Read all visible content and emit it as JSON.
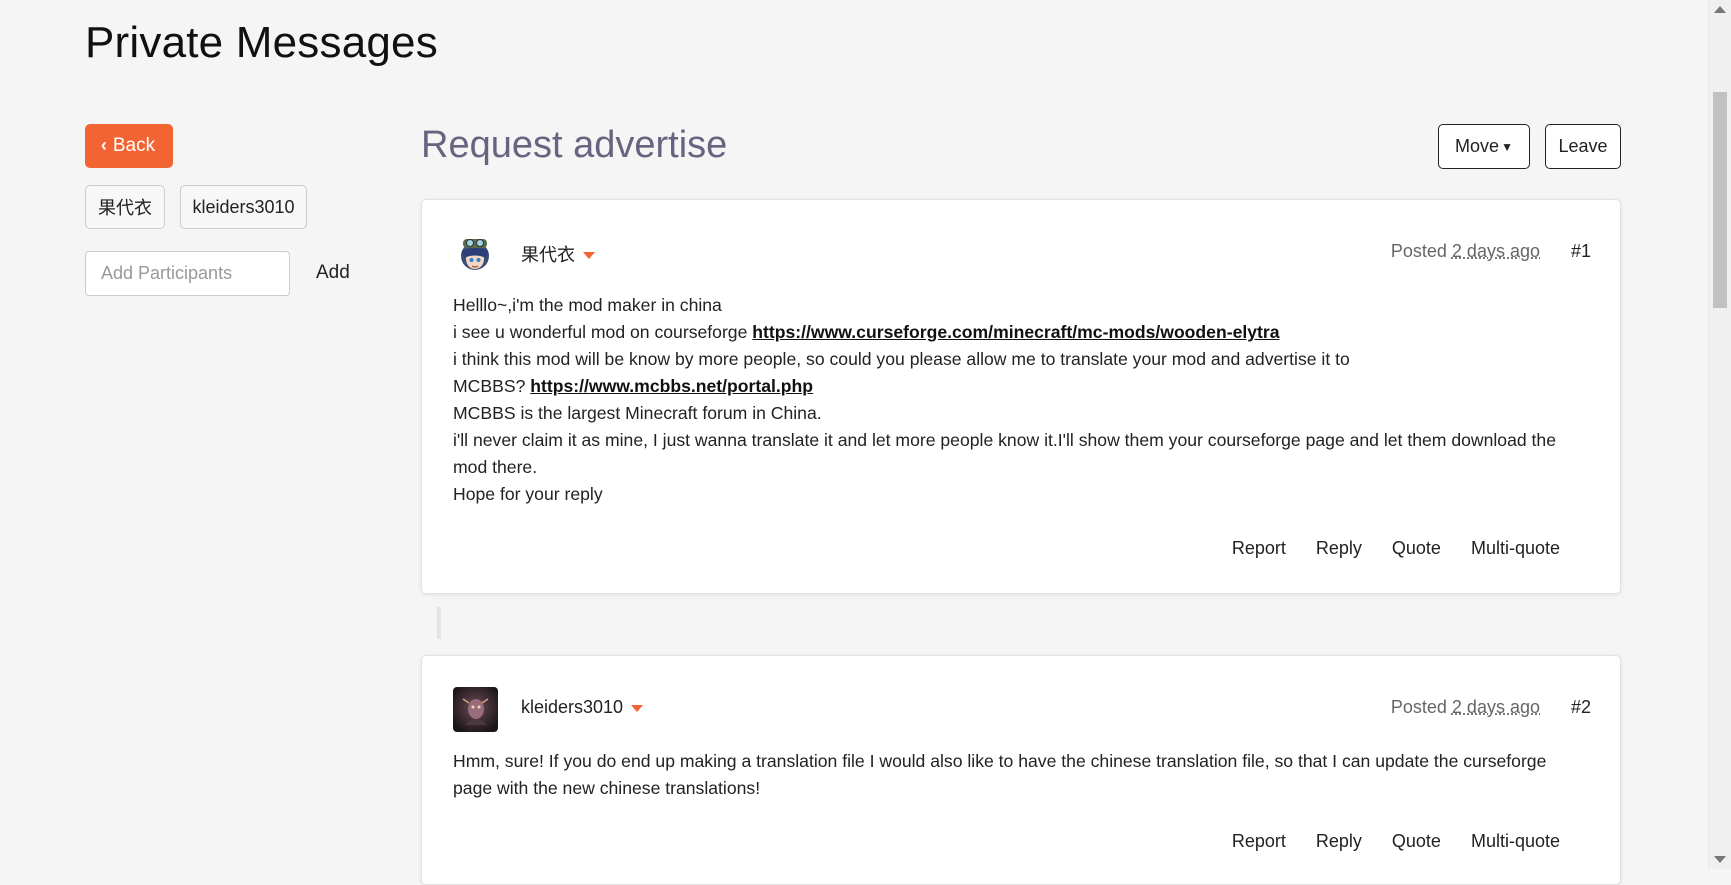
{
  "page": {
    "title": "Private Messages"
  },
  "sidebar": {
    "back_label": "Back",
    "participants": [
      "果代衣",
      "kleiders3010"
    ],
    "add_placeholder": "Add Participants",
    "add_label": "Add"
  },
  "conversation": {
    "title": "Request advertise",
    "move_label": "Move",
    "leave_label": "Leave"
  },
  "posts": [
    {
      "author": "果代衣",
      "posted_prefix": "Posted",
      "posted_time": "2 days ago",
      "number": "#1",
      "lines": {
        "l1": "Helllo~,i'm the mod maker in china",
        "l2_text": "i see u wonderful mod on courseforge ",
        "l2_link": "https://www.curseforge.com/minecraft/mc-mods/wooden-elytra",
        "l3": "i think this mod will be know by more people, so could you please allow me to translate your mod and advertise it to",
        "l4_text": "MCBBS? ",
        "l4_link": "https://www.mcbbs.net/portal.php",
        "l5": "MCBBS is the largest Minecraft forum in China.",
        "l6": "i'll never claim it as mine, I just wanna translate it and let more people know it.I'll show them your courseforge page and let them download the mod there.",
        "l7": "Hope for your reply"
      },
      "actions": [
        "Report",
        "Reply",
        "Quote",
        "Multi-quote"
      ]
    },
    {
      "author": "kleiders3010",
      "posted_prefix": "Posted",
      "posted_time": "2 days ago",
      "number": "#2",
      "lines": {
        "l1": "Hmm, sure! If you do end up making a translation file I would also like to have the chinese translation file, so that I can update the curseforge page with the new chinese translations!"
      },
      "actions": [
        "Report",
        "Reply",
        "Quote",
        "Multi-quote"
      ]
    }
  ],
  "colors": {
    "accent": "#f26532",
    "title": "#6a6380"
  }
}
